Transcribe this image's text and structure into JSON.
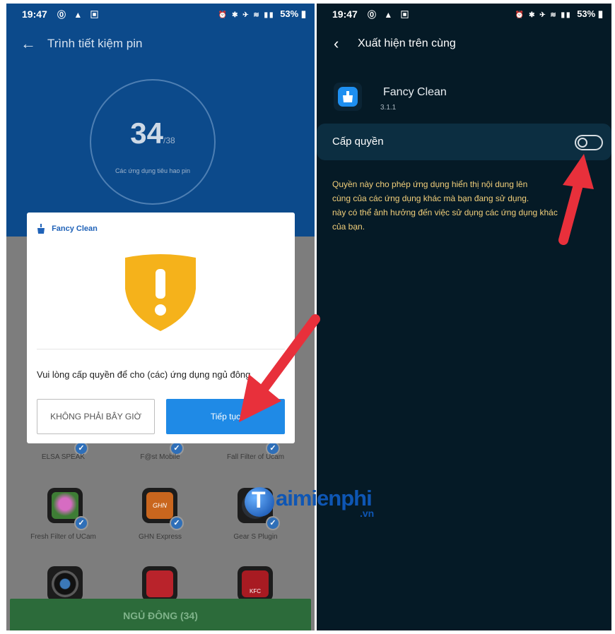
{
  "left_screen": {
    "status_bar": {
      "time": "19:47",
      "left_icons": "⓪ ▲ ▣",
      "signal_icons": "⏰ ✱ ✈ ≋ ▮▮",
      "battery": "53%"
    },
    "app_bar": {
      "title": "Trình tiết kiệm pin"
    },
    "counter": {
      "value": "34",
      "total": "/38",
      "label": "Các ứng dụng tiêu hao pin"
    },
    "apps_row1": [
      "ELSA SPEAK",
      "F@st Mobile",
      "Fall Filter of Ucam"
    ],
    "apps_row2": [
      "Fresh Filter of UCam",
      "GHN Express",
      "Gear S Plugin"
    ],
    "ghn_logo_text": "GHN",
    "kfc_logo_text": "KFC",
    "sleep_button": "NGỦ ĐÔNG (34)",
    "dialog": {
      "app_name": "Fancy Clean",
      "message": "Vui lòng cấp quyền để cho (các) ứng dụng ngủ đông",
      "later_button": "KHÔNG PHẢI BÂY GIỜ",
      "next_button": "Tiếp tục"
    }
  },
  "right_screen": {
    "status_bar": {
      "time": "19:47",
      "left_icons": "⓪ ▲ ▣",
      "signal_icons": "⏰ ✱ ✈ ≋ ▮▮",
      "battery": "53%"
    },
    "app_bar": {
      "title": "Xuất hiện trên cùng"
    },
    "app": {
      "name": "Fancy Clean",
      "version": "3.1.1"
    },
    "permission": {
      "label": "Cấp quyền",
      "enabled": false,
      "description_lines": [
        "Quyền này cho phép ứng dụng hiển thị nội dung lên",
        "cùng của các ứng dụng khác mà bạn đang sử dụng.",
        "này có thể ảnh hưởng đến việc sử dụng các ứng dụng khác",
        "của bạn."
      ]
    }
  },
  "watermark": {
    "brand": "aimienphi",
    "initial": "T",
    "domain": ".vn"
  },
  "colors": {
    "left_header": "#0c4a8b",
    "dialog_primary": "#1f8ae6",
    "shield": "#f5b21b",
    "right_background": "#051a26",
    "description_text": "#f2cf7a",
    "arrow": "#e8303b"
  }
}
